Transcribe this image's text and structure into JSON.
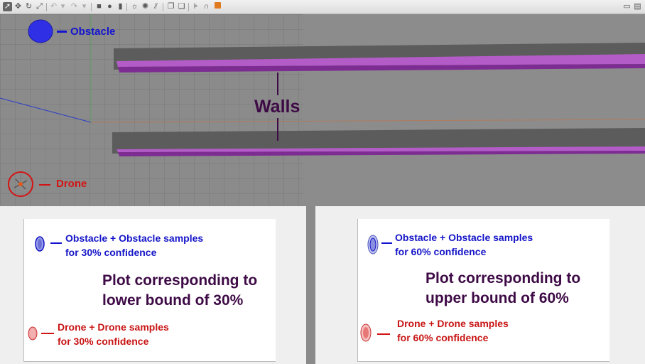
{
  "toolbar": {
    "icons": [
      "select-arrow-icon",
      "move-icon",
      "rotate-icon",
      "scale-icon",
      "undo-icon",
      "redo-icon",
      "box-icon",
      "sphere-icon",
      "cylinder-icon",
      "point-light-icon",
      "spot-light-icon",
      "directional-light-icon",
      "copy-icon",
      "paste-icon",
      "align-icon",
      "snap-icon",
      "headphones-icon",
      "record-icon",
      "screenshot-icon",
      "log-icon"
    ]
  },
  "scene": {
    "obstacle_label": "Obstacle",
    "drone_label": "Drone",
    "walls_label": "Walls"
  },
  "left_plot": {
    "title_line1": "Plot corresponding to",
    "title_line2": "lower bound of 30%",
    "obstacle_line1": "Obstacle + Obstacle samples",
    "obstacle_line2": "for 30% confidence",
    "drone_line1": "Drone + Drone samples",
    "drone_line2": "for 30% confidence"
  },
  "right_plot": {
    "title_line1": "Plot corresponding to",
    "title_line2": "upper bound of 60%",
    "obstacle_line1": "Obstacle + Obstacle samples",
    "obstacle_line2": "for 60% confidence",
    "drone_line1": "Drone + Drone samples",
    "drone_line2": "for 60% confidence"
  },
  "colors": {
    "obstacle": "#1414d0",
    "drone": "#d41414",
    "wall": "#9a3fb0",
    "title": "#3e0a46"
  }
}
